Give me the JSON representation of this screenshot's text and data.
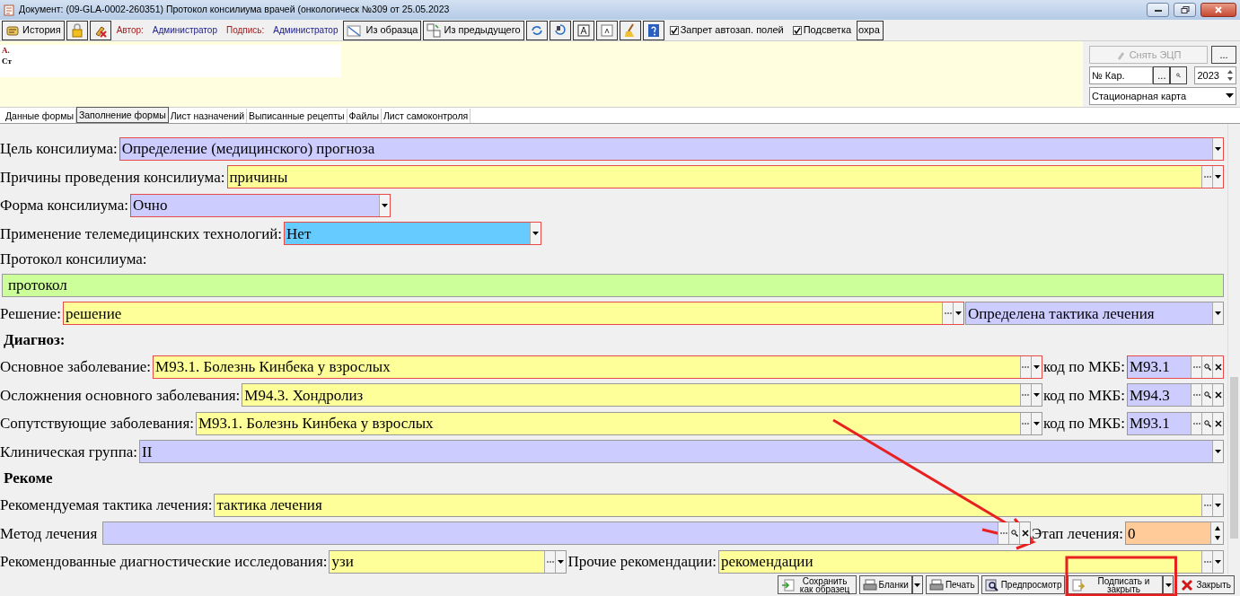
{
  "window": {
    "title": "Документ: (09-GLA-0002-260351) Протокол консилиума врачей (онкологическ №309 от 25.05.2023"
  },
  "toolbar": {
    "history_button": "История",
    "author_label": "Автор:",
    "author": "Администратор",
    "signature_label": "Подпись:",
    "signer": "Администратор",
    "from_template_button": "Из образца",
    "from_previous_button": "Из предыдущего",
    "checkboxes": [
      {
        "label": "Запрет автозап. полей",
        "checked": true
      },
      {
        "label": "Подсветка",
        "checked": true
      }
    ],
    "cut_button": "охра"
  },
  "header": {
    "patient_name": "А.",
    "patient_status": "Ст",
    "sign_remove_button": {
      "label": "Снять ЭЦП",
      "disabled": true
    },
    "more_button": "...",
    "card_number": "№ Кар.",
    "card_more_button": "...",
    "year": "2023",
    "card_type": "Стационарная карта"
  },
  "tabs": [
    {
      "label": "Данные формы",
      "selected": false
    },
    {
      "label": "Заполнение формы",
      "selected": true
    },
    {
      "label": "Лист назначений",
      "selected": false
    },
    {
      "label": "Выписанные рецепты",
      "selected": false
    },
    {
      "label": "Файлы",
      "selected": false
    },
    {
      "label": "Лист самоконтроля",
      "selected": false
    }
  ],
  "form": {
    "rows": [
      {
        "kind": "fields",
        "items": [
          {
            "kind": "label",
            "text": "Цель консилиума:"
          },
          {
            "kind": "field",
            "value": "Определение (медицинского) прогноза",
            "color": "#ccccff",
            "flagged": true,
            "buttons": [
              {
                "kind": "dropdown"
              }
            ]
          }
        ]
      },
      {
        "kind": "fields",
        "items": [
          {
            "kind": "label",
            "text": "Причины проведения консилиума:"
          },
          {
            "kind": "field",
            "value": "причины",
            "color": "#ffff99",
            "flagged": true,
            "buttons": [
              {
                "kind": "more"
              },
              {
                "kind": "dropdown"
              }
            ]
          }
        ]
      },
      {
        "kind": "fields",
        "items": [
          {
            "kind": "label",
            "text": "Форма консилиума:"
          },
          {
            "kind": "field",
            "value": "Очно",
            "color": "#ccccff",
            "flagged": true,
            "buttons": [
              {
                "kind": "dropdown"
              }
            ]
          }
        ]
      },
      {
        "kind": "fields",
        "items": [
          {
            "kind": "label",
            "text": "Применение телемедицинских технологий:"
          },
          {
            "kind": "field",
            "value": "Нет",
            "color": "#66ccff",
            "flagged": true,
            "buttons": [
              {
                "kind": "dropdown"
              }
            ]
          }
        ]
      },
      {
        "kind": "caption",
        "items": [
          {
            "kind": "label",
            "text": "Протокол консилиума:"
          }
        ]
      },
      {
        "kind": "fields",
        "items": [
          {
            "kind": "field",
            "value": "протокол",
            "color": "#ccff99",
            "flagged": false
          }
        ]
      },
      {
        "kind": "fields",
        "items": [
          {
            "kind": "label",
            "text": "Решение:"
          },
          {
            "kind": "field",
            "value": "решение",
            "color": "#ffff99",
            "flagged": true,
            "buttons": [
              {
                "kind": "more"
              },
              {
                "kind": "dropdown"
              }
            ]
          },
          {
            "kind": "field",
            "value": "Определена тактика лечения",
            "color": "#ccccff",
            "flagged": false,
            "buttons": [
              {
                "kind": "dropdown"
              }
            ]
          }
        ]
      },
      {
        "kind": "heading",
        "items": [
          {
            "kind": "label",
            "text": "Диагноз:"
          }
        ]
      },
      {
        "kind": "fields",
        "items": [
          {
            "kind": "label",
            "text": "Основное заболевание:"
          },
          {
            "kind": "field",
            "value": "M93.1. Болезнь Кинбека у взрослых",
            "color": "#ffff99",
            "flagged": true,
            "buttons": [
              {
                "kind": "more"
              },
              {
                "kind": "dropdown"
              }
            ]
          },
          {
            "kind": "label",
            "text": "код по МКБ:"
          },
          {
            "kind": "field",
            "value": "M93.1",
            "color": "#ccccff",
            "flagged": true,
            "buttons": [
              {
                "kind": "more"
              },
              {
                "kind": "search"
              },
              {
                "kind": "clear"
              }
            ]
          }
        ]
      },
      {
        "kind": "fields",
        "items": [
          {
            "kind": "label",
            "text": "Осложнения основного заболевания:"
          },
          {
            "kind": "field",
            "value": "M94.3. Хондролиз",
            "color": "#ffff99",
            "flagged": false,
            "buttons": [
              {
                "kind": "more"
              },
              {
                "kind": "dropdown"
              }
            ]
          },
          {
            "kind": "label",
            "text": "код по МКБ:"
          },
          {
            "kind": "field",
            "value": "M94.3",
            "color": "#ccccff",
            "flagged": false,
            "buttons": [
              {
                "kind": "more"
              },
              {
                "kind": "search"
              },
              {
                "kind": "clear"
              }
            ]
          }
        ]
      },
      {
        "kind": "fields",
        "items": [
          {
            "kind": "label",
            "text": "Сопутствующие заболевания:"
          },
          {
            "kind": "field",
            "value": "M93.1. Болезнь Кинбека у взрослых",
            "color": "#ffff99",
            "flagged": false,
            "buttons": [
              {
                "kind": "more"
              },
              {
                "kind": "dropdown"
              }
            ]
          },
          {
            "kind": "label",
            "text": "код по МКБ:"
          },
          {
            "kind": "field",
            "value": "M93.1",
            "color": "#ccccff",
            "flagged": false,
            "buttons": [
              {
                "kind": "more"
              },
              {
                "kind": "search"
              },
              {
                "kind": "clear"
              }
            ]
          }
        ]
      },
      {
        "kind": "fields",
        "items": [
          {
            "kind": "label",
            "text": "Клиническая группа:"
          },
          {
            "kind": "field",
            "value": "II",
            "color": "#ccccff",
            "flagged": false,
            "buttons": [
              {
                "kind": "dropdown"
              }
            ]
          }
        ]
      },
      {
        "kind": "heading",
        "items": [
          {
            "kind": "label",
            "text": "Рекоме"
          }
        ]
      },
      {
        "kind": "fields",
        "items": [
          {
            "kind": "label",
            "text": "Рекомендуемая тактика лечения:"
          },
          {
            "kind": "field",
            "value": "тактика лечения",
            "color": "#ffff99",
            "flagged": false,
            "buttons": [
              {
                "kind": "more"
              },
              {
                "kind": "dropdown"
              }
            ]
          }
        ]
      },
      {
        "kind": "fields",
        "items": [
          {
            "kind": "label",
            "text": "Метод лечения"
          },
          {
            "kind": "field",
            "color": "#ccccff",
            "flagged": false,
            "buttons": [
              {
                "kind": "more"
              },
              {
                "kind": "search"
              },
              {
                "kind": "clear"
              }
            ]
          },
          {
            "kind": "label",
            "text": "Этап лечения:"
          },
          {
            "kind": "field",
            "value": "0",
            "color": "#ffcc99",
            "flagged": false,
            "buttons": [
              {
                "kind": "spin"
              }
            ]
          }
        ]
      },
      {
        "kind": "fields",
        "items": [
          {
            "kind": "label",
            "text": "Рекомендованные диагностические исследования:"
          },
          {
            "kind": "field",
            "value": "узи",
            "color": "#ffff99",
            "flagged": false,
            "buttons": [
              {
                "kind": "more"
              },
              {
                "kind": "dropdown"
              }
            ]
          },
          {
            "kind": "label",
            "text": "Прочие рекомендации:"
          },
          {
            "kind": "field",
            "value": "рекомендации",
            "color": "#ffff99",
            "flagged": false,
            "buttons": [
              {
                "kind": "more"
              },
              {
                "kind": "dropdown"
              }
            ]
          }
        ]
      }
    ]
  },
  "bottom_buttons": [
    {
      "label": "Сохранить как образец",
      "dropdown": false
    },
    {
      "label": "Бланки",
      "dropdown": true
    },
    {
      "label": "Печать",
      "dropdown": false
    },
    {
      "label": "Предпросмотр",
      "dropdown": false
    },
    {
      "label": "Подписать и закрыть",
      "dropdown": true
    },
    {
      "label": "Закрыть",
      "dropdown": false
    }
  ],
  "annotations": [
    {
      "kind": "arrow"
    },
    {
      "kind": "arrow"
    },
    {
      "kind": "frame"
    }
  ]
}
